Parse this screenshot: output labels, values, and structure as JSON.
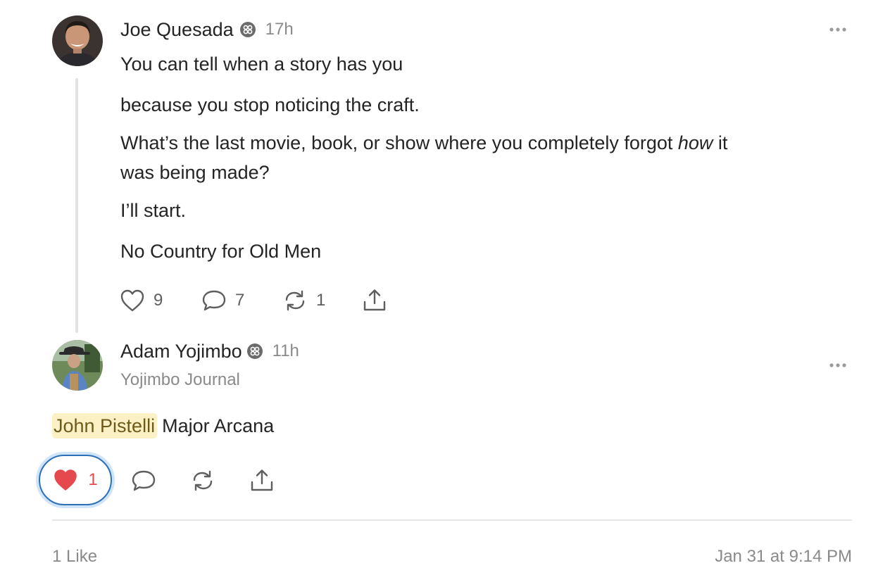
{
  "post": {
    "author": "Joe Quesada",
    "time": "17h",
    "lines": [
      "You can tell when a story has you",
      "because you stop noticing the craft."
    ],
    "question_part1": "What’s the last movie, book, or show where you completely forgot ",
    "question_emphasis": "how",
    "question_part2": " it",
    "question_line2": "was being made?",
    "line_start": "I’ll start.",
    "line_answer": "No Country for Old Men",
    "actions": {
      "likes": "9",
      "replies": "7",
      "reposts": "1"
    },
    "icons": [
      "heart-icon",
      "comment-icon",
      "repost-icon",
      "share-icon",
      "more-options-icon",
      "badge-icon"
    ]
  },
  "reply": {
    "author": "Adam Yojimbo",
    "time": "11h",
    "subtitle": "Yojimbo Journal",
    "mention": "John Pistelli",
    "text": "Major Arcana",
    "actions": {
      "likes": "1"
    }
  },
  "footer": {
    "likes_label": "1 Like",
    "timestamp": "Jan 31 at 9:14 PM"
  },
  "colors": {
    "like_red": "#e5484d",
    "focus_blue": "#2c6fb6",
    "mention_bg": "#fcf1c4",
    "thread_line": "#e3e3e3"
  }
}
